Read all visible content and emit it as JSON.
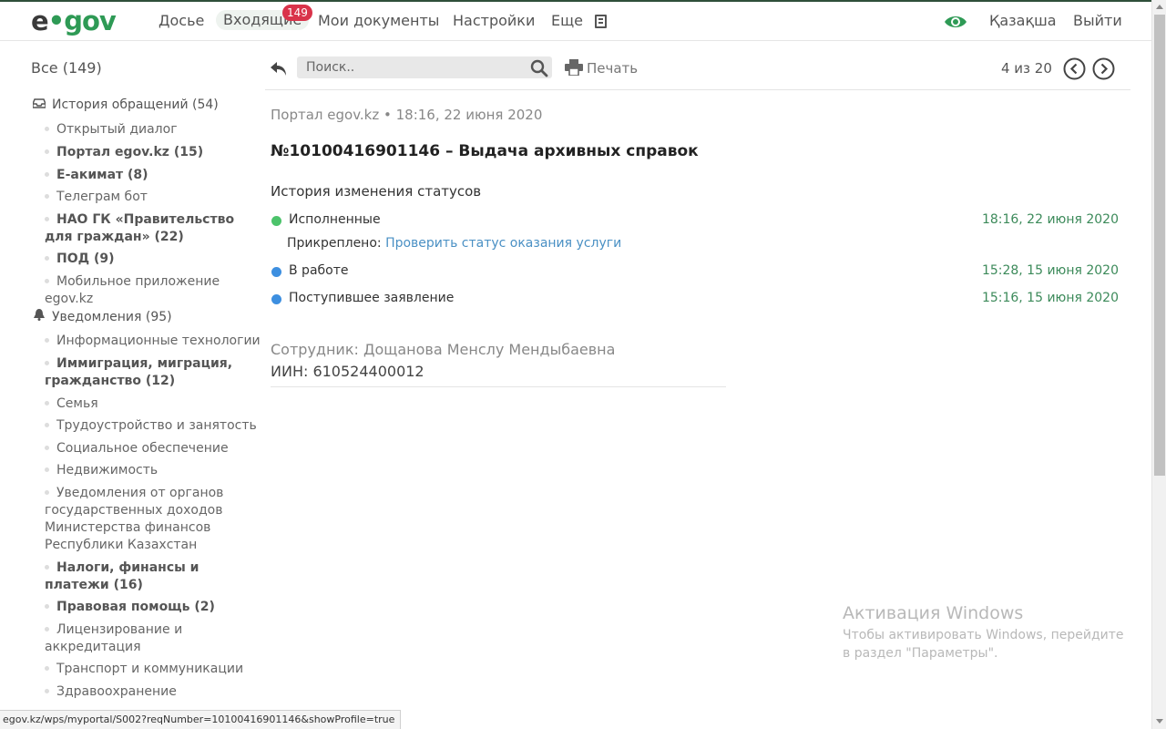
{
  "header": {
    "logo_prefix": "e",
    "logo_suffix": "gov",
    "nav": {
      "dossier": "Досье",
      "inbox": "Входящие",
      "inbox_badge": "149",
      "my_documents": "Мои документы",
      "settings": "Настройки",
      "more": "Еще"
    },
    "language": "Қазақша",
    "logout": "Выйти"
  },
  "sidebar": {
    "all": "Все (149)",
    "sections": [
      {
        "title": "История обращений (54)",
        "icon": "inbox-tray-icon",
        "items": [
          {
            "label": "Открытый диалог",
            "bold": false
          },
          {
            "label": "Портал egov.kz (15)",
            "bold": true
          },
          {
            "label": "E-акимат (8)",
            "bold": true
          },
          {
            "label": "Телеграм бот",
            "bold": false
          },
          {
            "label": "НАО ГК «Правительство для граждан» (22)",
            "bold": true
          },
          {
            "label": "ПОД (9)",
            "bold": true
          },
          {
            "label": "Мобильное приложение egov.kz",
            "bold": false
          }
        ]
      },
      {
        "title": "Уведомления (95)",
        "icon": "bell-icon",
        "items": [
          {
            "label": "Информационные технологии",
            "bold": false
          },
          {
            "label": "Иммиграция, миграция, гражданство (12)",
            "bold": true
          },
          {
            "label": "Семья",
            "bold": false
          },
          {
            "label": "Трудоустройство и занятость",
            "bold": false
          },
          {
            "label": "Социальное обеспечение",
            "bold": false
          },
          {
            "label": "Недвижимость",
            "bold": false
          },
          {
            "label": "Уведомления от органов государственных доходов Министерства финансов Республики Казахстан",
            "bold": false
          },
          {
            "label": "Налоги, финансы и платежи (16)",
            "bold": true
          },
          {
            "label": "Правовая помощь (2)",
            "bold": true
          },
          {
            "label": "Лицензирование и аккредитация",
            "bold": false
          },
          {
            "label": "Транспорт и коммуникации",
            "bold": false
          },
          {
            "label": "Здравоохранение",
            "bold": false
          }
        ]
      }
    ]
  },
  "toolbar": {
    "search_placeholder": "Поиск..",
    "print": "Печать",
    "pager": "4 из 20"
  },
  "message": {
    "meta": "Портал egov.kz • 18:16, 22 июня 2020",
    "title": "№10100416901146 – Выдача архивных справок",
    "history_title": "История изменения статусов",
    "statuses": [
      {
        "label": "Исполненные",
        "date": "18:16, 22 июня 2020",
        "color": "#4cc36b"
      },
      {
        "label": "В работе",
        "date": "15:28, 15 июня 2020",
        "color": "#3d8fe0"
      },
      {
        "label": "Поступившее заявление",
        "date": "15:16, 15 июня 2020",
        "color": "#3d8fe0"
      }
    ],
    "attached_label": "Прикреплено:",
    "attached_link": "Проверить статус оказания услуги",
    "employee": "Сотрудник: Дощанова Менслу Мендыбаевна",
    "iin": "ИИН: 610524400012"
  },
  "watermark": {
    "title": "Активация Windows",
    "text": "Чтобы активировать Windows, перейдите в раздел \"Параметры\"."
  },
  "status_url": "egov.kz/wps/myportal/S002?reqNumber=10100416901146&showProfile=true",
  "colors": {
    "brand_green": "#2e9a55",
    "badge_red": "#d9334a",
    "date_green": "#3c8a5a",
    "link_blue": "#4a90c4"
  }
}
